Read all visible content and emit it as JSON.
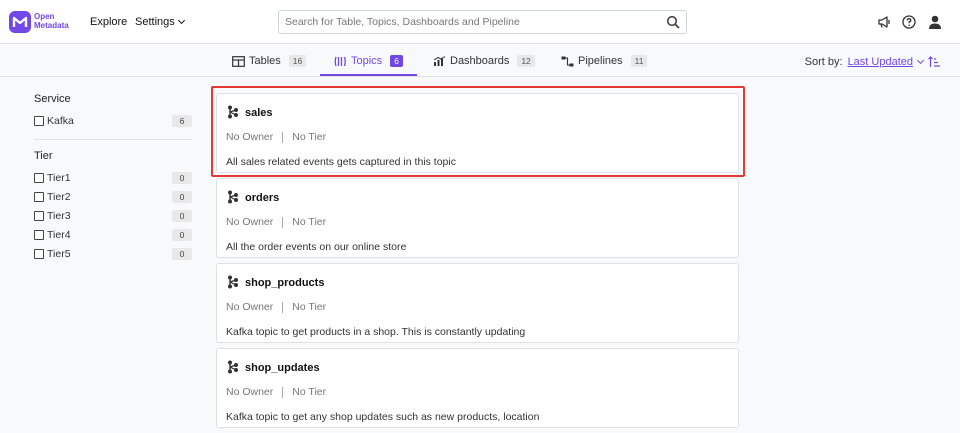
{
  "header": {
    "logo_line1": "Open",
    "logo_line2": "Metadata",
    "nav_explore": "Explore",
    "nav_settings": "Settings",
    "search_placeholder": "Search for Table, Topics, Dashboards and Pipeline",
    "accent": "#7147e8"
  },
  "tabs": [
    {
      "label": "Tables",
      "count": "16",
      "icon": "table-icon"
    },
    {
      "label": "Topics",
      "count": "6",
      "icon": "topic-icon"
    },
    {
      "label": "Dashboards",
      "count": "12",
      "icon": "dashboard-icon"
    },
    {
      "label": "Pipelines",
      "count": "11",
      "icon": "pipeline-icon"
    }
  ],
  "sort": {
    "label": "Sort by:",
    "value": "Last Updated"
  },
  "sidebar": {
    "service_title": "Service",
    "service_items": [
      {
        "label": "Kafka",
        "count": "6"
      }
    ],
    "tier_title": "Tier",
    "tier_items": [
      {
        "label": "Tier1",
        "count": "0"
      },
      {
        "label": "Tier2",
        "count": "0"
      },
      {
        "label": "Tier3",
        "count": "0"
      },
      {
        "label": "Tier4",
        "count": "0"
      },
      {
        "label": "Tier5",
        "count": "0"
      }
    ]
  },
  "cards": [
    {
      "title": "sales",
      "owner": "No Owner",
      "tier": "No Tier",
      "description": "All sales related events gets captured in this topic"
    },
    {
      "title": "orders",
      "owner": "No Owner",
      "tier": "No Tier",
      "description": "All the order events on our online store"
    },
    {
      "title": "shop_products",
      "owner": "No Owner",
      "tier": "No Tier",
      "description": "Kafka topic to get products in a shop. This is constantly updating"
    },
    {
      "title": "shop_updates",
      "owner": "No Owner",
      "tier": "No Tier",
      "description": "Kafka topic to get any shop updates such as new products, location"
    }
  ]
}
